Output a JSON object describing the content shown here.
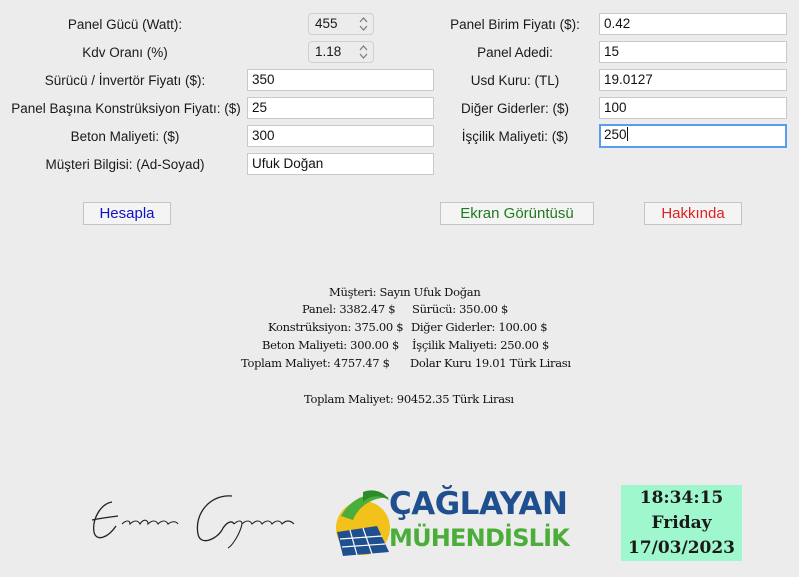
{
  "left_form": {
    "panel_power": {
      "label": "Panel Gücü (Watt):",
      "value": "455"
    },
    "vat_rate": {
      "label": "Kdv Oranı (%)",
      "value": "1.18"
    },
    "inverter_price": {
      "label": "Sürücü / İnvertör Fiyatı ($):",
      "value": "350"
    },
    "construction_price": {
      "label": "Panel Başına Konstrüksiyon Fiyatı: ($)",
      "value": "25"
    },
    "concrete_cost": {
      "label": "Beton Maliyeti: ($)",
      "value": "300"
    },
    "customer": {
      "label": "Müşteri Bilgisi: (Ad-Soyad)",
      "value": "Ufuk Doğan"
    }
  },
  "right_form": {
    "panel_unit_price": {
      "label": "Panel Birim Fiyatı ($):",
      "value": "0.42"
    },
    "panel_count": {
      "label": "Panel Adedi:",
      "value": "15"
    },
    "usd_rate": {
      "label": "Usd Kuru: (TL)",
      "value": "19.0127"
    },
    "other_costs": {
      "label": "Diğer Giderler: ($)",
      "value": "100"
    },
    "labor_cost": {
      "label": "İşçilik Maliyeti: ($)",
      "value": "250"
    }
  },
  "buttons": {
    "calculate": {
      "label": "Hesapla",
      "color": "#1010c8"
    },
    "screenshot": {
      "label": "Ekran Görüntüsü",
      "color": "#1e7a1e"
    },
    "about": {
      "label": "Hakkında",
      "color": "#e02020"
    }
  },
  "output": {
    "customer": "Müşteri: Sayın Ufuk Doğan",
    "panel": "Panel: 3382.47 $",
    "inverter": "Sürücü: 350.00 $",
    "construction": "Konstrüksiyon: 375.00 $",
    "other": "Diğer Giderler: 100.00 $",
    "concrete": "Beton Maliyeti: 300.00 $",
    "labor": "İşçilik Maliyeti: 250.00 $",
    "total_usd": "Toplam Maliyet: 4757.47 $",
    "dollar_rate": "Dolar Kuru 19.01 Türk Lirası",
    "total_try": "Toplam Maliyet: 90452.35 Türk Lirası"
  },
  "footer": {
    "signature": "Ercan Çağlayan",
    "logo_line1": "ÇAĞLAYAN",
    "logo_line2": "MÜHENDİSLİK",
    "logo_color": "#1f4f8f",
    "logo_green": "#4cae3a",
    "clock_time": "18:34:15",
    "clock_day": "Friday",
    "clock_date": "17/03/2023",
    "clock_bg": "#9ff7cd"
  }
}
